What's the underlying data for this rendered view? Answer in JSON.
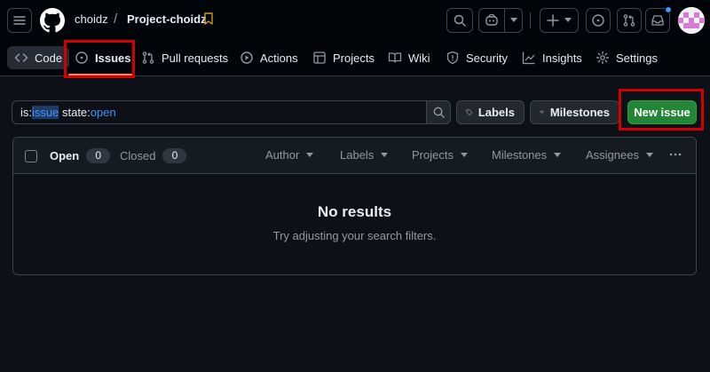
{
  "header": {
    "owner": "choidz",
    "separator": "/",
    "repo": "Project-choidz"
  },
  "tabs": [
    {
      "label": "Code",
      "icon": "code-icon"
    },
    {
      "label": "Issues",
      "icon": "issue-opened-icon"
    },
    {
      "label": "Pull requests",
      "icon": "git-pull-request-icon"
    },
    {
      "label": "Actions",
      "icon": "play-icon"
    },
    {
      "label": "Projects",
      "icon": "table-icon"
    },
    {
      "label": "Wiki",
      "icon": "book-icon"
    },
    {
      "label": "Security",
      "icon": "shield-icon"
    },
    {
      "label": "Insights",
      "icon": "graph-icon"
    },
    {
      "label": "Settings",
      "icon": "gear-icon"
    }
  ],
  "filter": {
    "query_parts": [
      {
        "text": "is:",
        "kind": "key"
      },
      {
        "text": "issue",
        "kind": "value-selected"
      },
      {
        "text": " state:",
        "kind": "key"
      },
      {
        "text": "open",
        "kind": "value"
      }
    ]
  },
  "buttons": {
    "labels": "Labels",
    "milestones": "Milestones",
    "new_issue": "New issue"
  },
  "issues_box": {
    "open_label": "Open",
    "open_count": "0",
    "closed_label": "Closed",
    "closed_count": "0",
    "filters": [
      "Author",
      "Labels",
      "Projects",
      "Milestones",
      "Assignees"
    ],
    "empty_title": "No results",
    "empty_subtitle": "Try adjusting your search filters."
  },
  "colors": {
    "background": "#0d1117",
    "header_bg": "#010409",
    "border": "#3d444d",
    "primary_green": "#238636",
    "link_blue": "#4493f8",
    "tab_underline": "#f78166",
    "highlight_red": "#d40000"
  }
}
